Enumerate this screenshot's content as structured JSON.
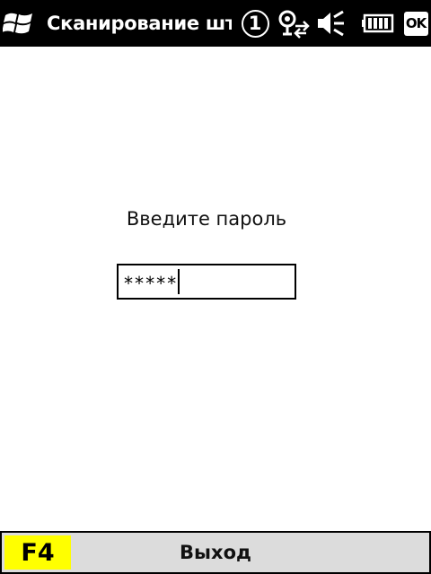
{
  "titlebar": {
    "title": "Сканирование штр",
    "notification_count": "1",
    "ok_label": "OK",
    "icons": [
      "windows-start-icon",
      "notification-count-icon",
      "connectivity-icon",
      "volume-mute-icon",
      "battery-icon",
      "ok-button"
    ]
  },
  "form": {
    "prompt": "Введите пароль",
    "password_value": "*****"
  },
  "softbar": {
    "key_label": "F4",
    "action_label": "Выход",
    "key_color": "#ffff00",
    "bar_color": "#dcdcdc"
  }
}
